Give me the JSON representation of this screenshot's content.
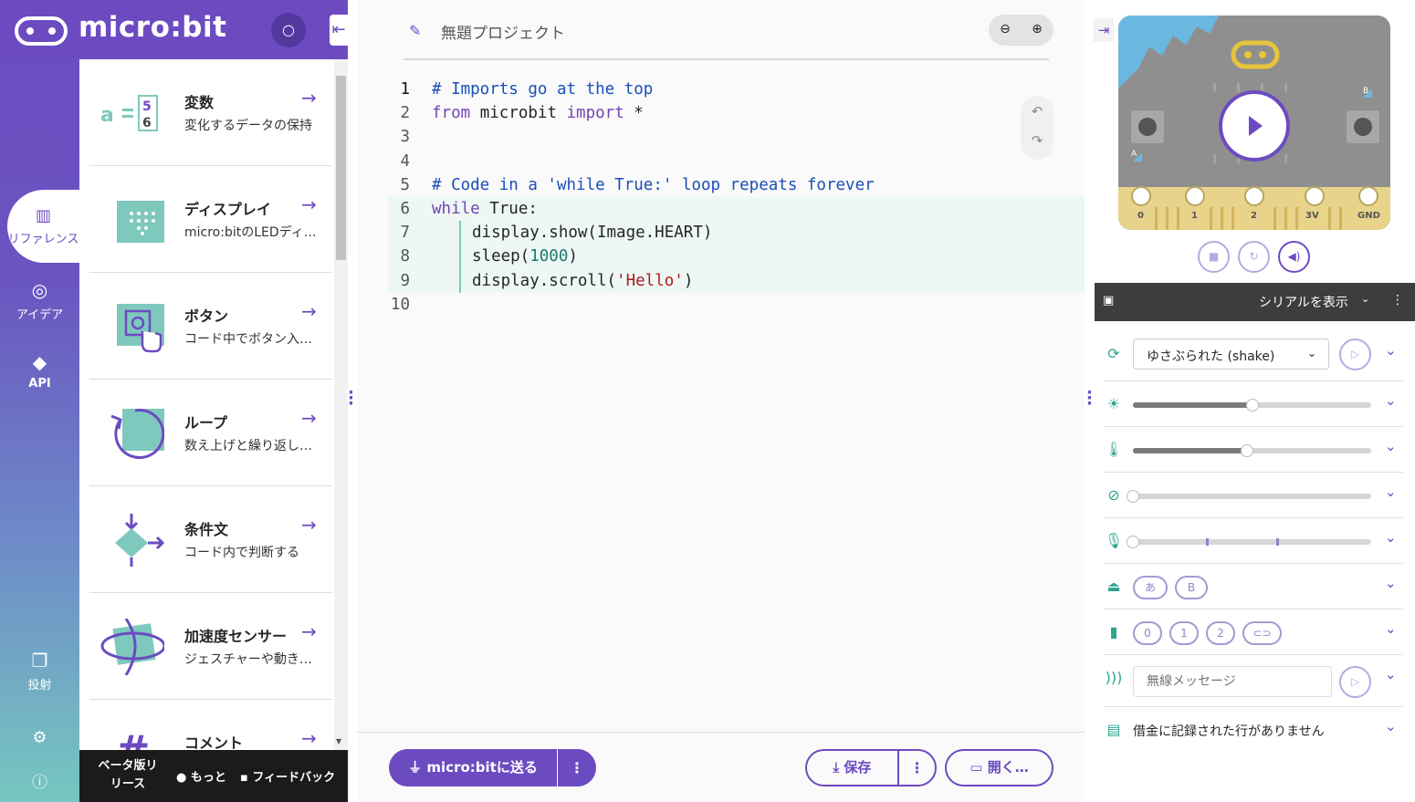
{
  "brand": {
    "name": "micro:bit"
  },
  "rail": {
    "tabs": [
      {
        "label": "リファレンス",
        "icon": "book-icon"
      },
      {
        "label": "アイデア",
        "icon": "lightbulb-icon"
      },
      {
        "label": "API",
        "icon": "python-icon"
      },
      {
        "label": "投射",
        "icon": "copy-icon"
      }
    ]
  },
  "reference": {
    "items": [
      {
        "title": "変数",
        "desc": "変化するデータの保持"
      },
      {
        "title": "ディスプレイ",
        "desc": "micro:bitのLEDディスプレイ"
      },
      {
        "title": "ボタン",
        "desc": "コード中でボタン入力を使う"
      },
      {
        "title": "ループ",
        "desc": "数え上げと繰り返し処理"
      },
      {
        "title": "条件文",
        "desc": "コード内で判断する"
      },
      {
        "title": "加速度センサー",
        "desc": "ジェスチャーや動きの検出"
      },
      {
        "title": "コメント",
        "desc": ""
      }
    ],
    "footer": {
      "beta": "ベータ版リリース",
      "more": "もっと",
      "feedback": "フィードバック"
    }
  },
  "editor": {
    "project_name": "無題プロジェクト",
    "line_numbers": [
      "1",
      "2",
      "3",
      "4",
      "5",
      "6",
      "7",
      "8",
      "9",
      "10"
    ],
    "send_label": "micro:bitに送る",
    "save_label": "保存",
    "open_label": "開く…"
  },
  "simulator": {
    "pins": [
      "0",
      "1",
      "2",
      "3V",
      "GND"
    ],
    "button_a": "A",
    "button_b": "B",
    "serial_label": "シリアルを表示",
    "gesture_value": "ゆさぶられた (shake)",
    "buttons_pills": [
      "あ",
      "B"
    ],
    "touch_pills": [
      "0",
      "1",
      "2"
    ],
    "radio_placeholder": "無線メッセージ",
    "datalog_text": "借金に記録された行がありません",
    "sliders": [
      {
        "name": "light",
        "level": 0.5
      },
      {
        "name": "temperature",
        "level": 0.48
      },
      {
        "name": "compass",
        "level": 0.0
      },
      {
        "name": "sound",
        "level": 0.0
      }
    ]
  },
  "colors": {
    "brand": "#6c4bc1",
    "teal": "#2ea38f"
  }
}
